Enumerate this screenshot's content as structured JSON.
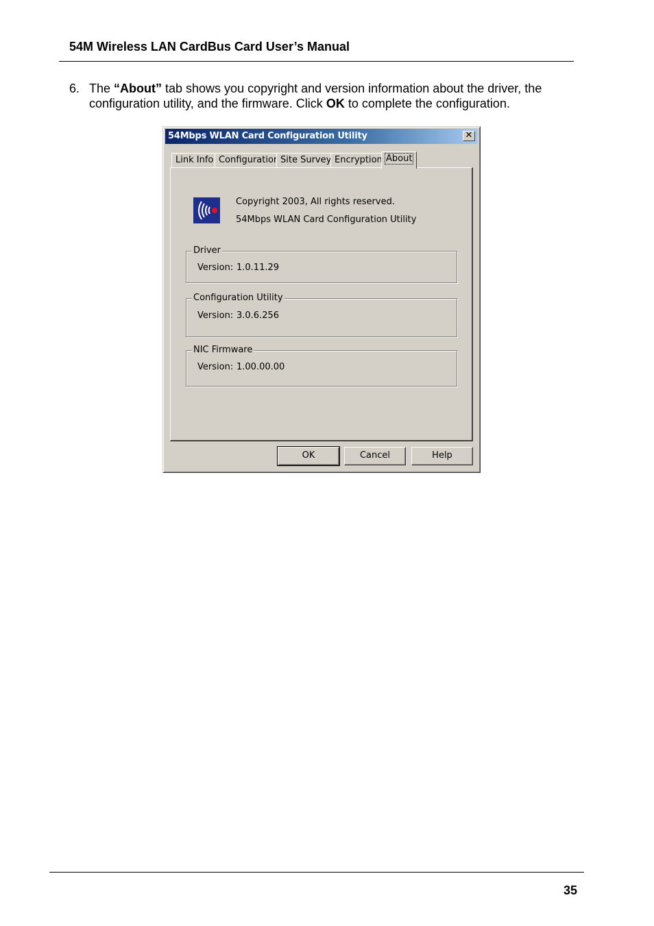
{
  "header": {
    "title": "54M Wireless LAN CardBus Card User’s Manual"
  },
  "step": {
    "number": "6.",
    "text_before": "The ",
    "bold_about": "“About”",
    "text_middle": " tab shows you copyright and version information about the driver, the configuration utility, and the firmware. Click ",
    "bold_ok": "OK",
    "text_after": " to complete the configuration."
  },
  "dialog": {
    "title": "54Mbps WLAN Card Configuration Utility",
    "close_glyph": "✕",
    "tabs": [
      {
        "label": "Link Info"
      },
      {
        "label": "Configuration"
      },
      {
        "label": "Site Survey"
      },
      {
        "label": "Encryption"
      },
      {
        "label": "About"
      }
    ],
    "active_tab": "About",
    "about": {
      "copyright": "Copyright 2003, All rights reserved.",
      "product": "54Mbps WLAN Card Configuration Utility",
      "logo_icon": "wireless-signal-icon"
    },
    "groups": [
      {
        "title": "Driver",
        "version_label": "Version:",
        "version": "1.0.11.29"
      },
      {
        "title": "Configuration Utility",
        "version_label": "Version:",
        "version": "3.0.6.256"
      },
      {
        "title": "NIC Firmware",
        "version_label": "Version:",
        "version": "1.00.00.00"
      }
    ],
    "buttons": {
      "ok": "OK",
      "cancel": "Cancel",
      "help": "Help"
    },
    "colors": {
      "face": "#d4d0c8",
      "title_start": "#0a246a",
      "title_end": "#a6caf0",
      "logo_bg": "#1f2e8c",
      "logo_dot": "#e8101e"
    }
  },
  "footer": {
    "page_number": "35"
  }
}
